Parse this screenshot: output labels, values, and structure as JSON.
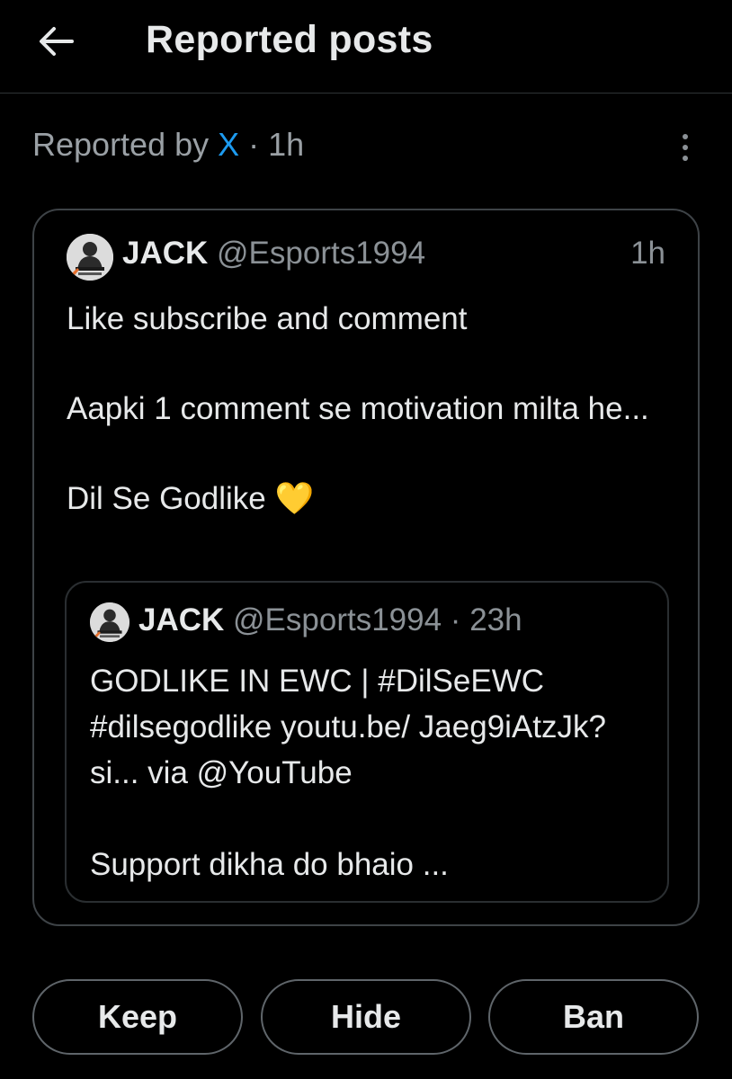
{
  "header": {
    "title": "Reported posts",
    "back_icon": "arrow-left-icon"
  },
  "report": {
    "prefix": "Reported by ",
    "reporter": "X",
    "separator": " · ",
    "time": "1h",
    "more_icon": "more-vertical-icon"
  },
  "post": {
    "author_name": "JACK",
    "author_handle": "@Esports1994",
    "time": "1h",
    "paragraphs": [
      "Like subscribe and comment",
      "Aapki 1 comment se motivation milta he...",
      "Dil Se Godlike 💛"
    ],
    "quoted": {
      "author_name": "JACK",
      "author_handle": "@Esports1994",
      "separator": " · ",
      "time": "23h",
      "paragraphs": [
        "GODLIKE IN EWC | #DilSeEWC #dilsegodlike youtu.be/ Jaeg9iAtzJk?si... via @YouTube",
        "Support dikha do bhaio ..."
      ]
    }
  },
  "actions": {
    "keep": "Keep",
    "hide": "Hide",
    "ban": "Ban"
  },
  "colors": {
    "background": "#000000",
    "link_blue": "#1d9bf0",
    "secondary_text": "#8b9196",
    "border": "#3e4347"
  }
}
